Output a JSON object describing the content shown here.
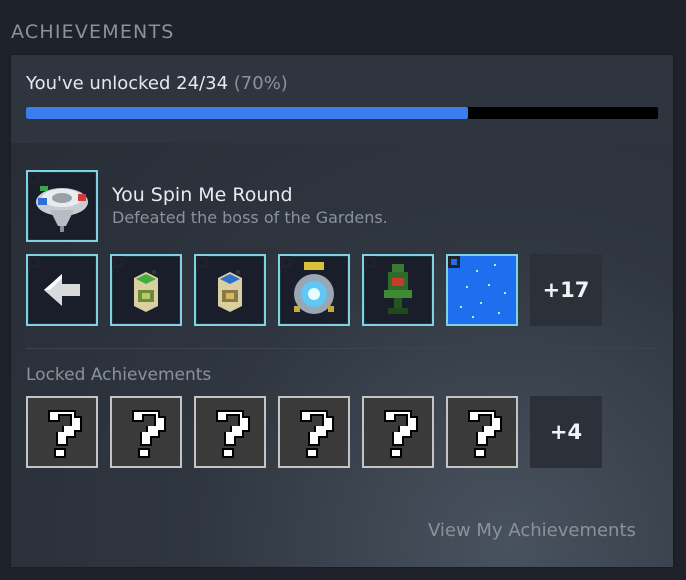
{
  "section": {
    "title": "ACHIEVEMENTS"
  },
  "progress": {
    "label": "You've unlocked 24/34",
    "percent_label": "(70%)",
    "fraction": 0.7,
    "fill_color": "#3a7dee"
  },
  "featured": {
    "title": "You Spin Me Round",
    "description": "Defeated the boss of the Gardens.",
    "icon": "spinning-top-icon"
  },
  "unlocked_icons": [
    "spinning-top-icon",
    "arrow-left-icon",
    "green-block-icon",
    "blue-block-icon",
    "robot-orb-icon",
    "plant-creature-icon",
    "starfield-icon"
  ],
  "unlocked_more": "+17",
  "locked": {
    "title": "Locked Achievements",
    "count_shown": 6,
    "more": "+4",
    "icon": "question-mark-icon"
  },
  "view_link": "View My Achievements"
}
